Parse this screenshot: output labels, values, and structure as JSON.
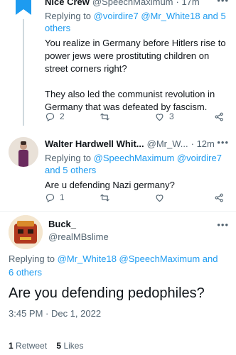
{
  "tweets": [
    {
      "name": "Nice Crew",
      "handle": "@SpeechMaximum",
      "time": "· 17m",
      "replying_prefix": "Replying to ",
      "replying_to": "@voirdire7 @Mr_White18 and 5 others",
      "text": "You realize in Germany before Hitlers rise to power jews were prostituting children on street corners right?\n\nThey also led the communist revolution in Germany that was defeated by fascism.",
      "replies": "2",
      "retweets": "",
      "likes": "3"
    },
    {
      "name": "Walter Hardwell Whit...",
      "handle": "@Mr_W...",
      "time": "· 12m",
      "replying_prefix": "Replying to ",
      "replying_to": "@SpeechMaximum @voirdire7 and 5 others",
      "text": "Are u defending Nazi germany?",
      "replies": "1",
      "retweets": "",
      "likes": ""
    }
  ],
  "main_tweet": {
    "name": "Buck_",
    "handle": "@realMBslime",
    "replying_prefix": "Replying to ",
    "replying_to": "@Mr_White18 @SpeechMaximum and 6 others",
    "text": "Are you defending pedophiles?",
    "timestamp": "3:45 PM · Dec 1, 2022",
    "retweet_count": "1",
    "retweet_label": "Retweet",
    "like_count": "5",
    "like_label": "Likes"
  },
  "more_glyph": "•••",
  "icons": [
    "reply-icon",
    "retweet-icon",
    "like-icon",
    "share-icon",
    "more-icon"
  ],
  "colors": {
    "accent": "#1d9bf0",
    "muted": "#536471",
    "text": "#0f1419",
    "border": "#eff3f4"
  }
}
